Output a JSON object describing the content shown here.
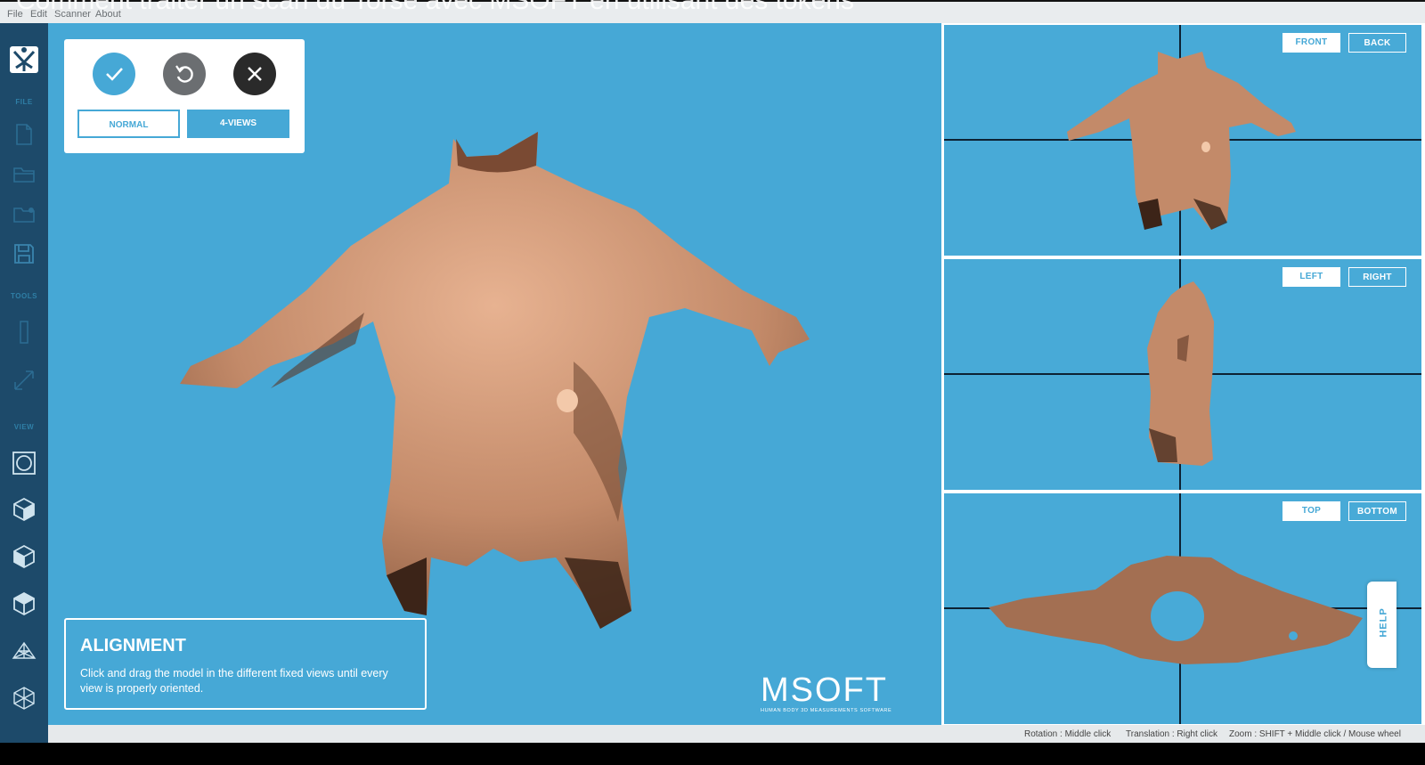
{
  "video_title": "Comment traiter un scan du Torse avec MSOFT en utilisant des tokens",
  "menubar": {
    "items": [
      "File",
      "Edit",
      "Scanner",
      "About"
    ]
  },
  "sidebar": {
    "sections": {
      "file": "FILE",
      "tools": "TOOLS",
      "view": "VIEW"
    },
    "icons": [
      "app-logo-icon",
      "new-file-icon",
      "open-folder-icon",
      "recent-folder-icon",
      "save-icon",
      "ruler-tool-icon",
      "measure-tool-icon",
      "view-circle-icon",
      "cube-front-icon",
      "cube-side-icon",
      "cube-top-icon",
      "wireframe-icon",
      "mesh-icon"
    ]
  },
  "toolbox": {
    "confirm_icon": "check-icon",
    "reset_icon": "reset-icon",
    "close_icon": "close-icon",
    "mode_normal": "NORMAL",
    "mode_4views": "4-VIEWS",
    "active_mode": "4-VIEWS",
    "colors": {
      "confirm": "#46a8d6",
      "reset": "#6b6e71",
      "close": "#2a2a2a"
    }
  },
  "info": {
    "title": "ALIGNMENT",
    "description": "Click and drag the model in the different fixed views until every view is properly oriented."
  },
  "brand": {
    "logo": "MSOFT",
    "tagline": "HUMAN BODY 3D MEASUREMENTS SOFTWARE"
  },
  "views": {
    "panel1": {
      "btn_a": "FRONT",
      "btn_b": "BACK",
      "active": "FRONT"
    },
    "panel2": {
      "btn_a": "LEFT",
      "btn_b": "RIGHT",
      "active": "LEFT"
    },
    "panel3": {
      "btn_a": "TOP",
      "btn_b": "BOTTOM",
      "active": "TOP"
    }
  },
  "help_label": "HELP",
  "status": {
    "rotation": "Rotation : Middle click",
    "translation": "Translation : Right click",
    "zoom": "Zoom : SHIFT + Middle click / Mouse wheel"
  },
  "colors": {
    "viewport_bg": "#46a8d6",
    "sidebar_bg": "#1d4a6a",
    "model": "#c98e6e"
  }
}
